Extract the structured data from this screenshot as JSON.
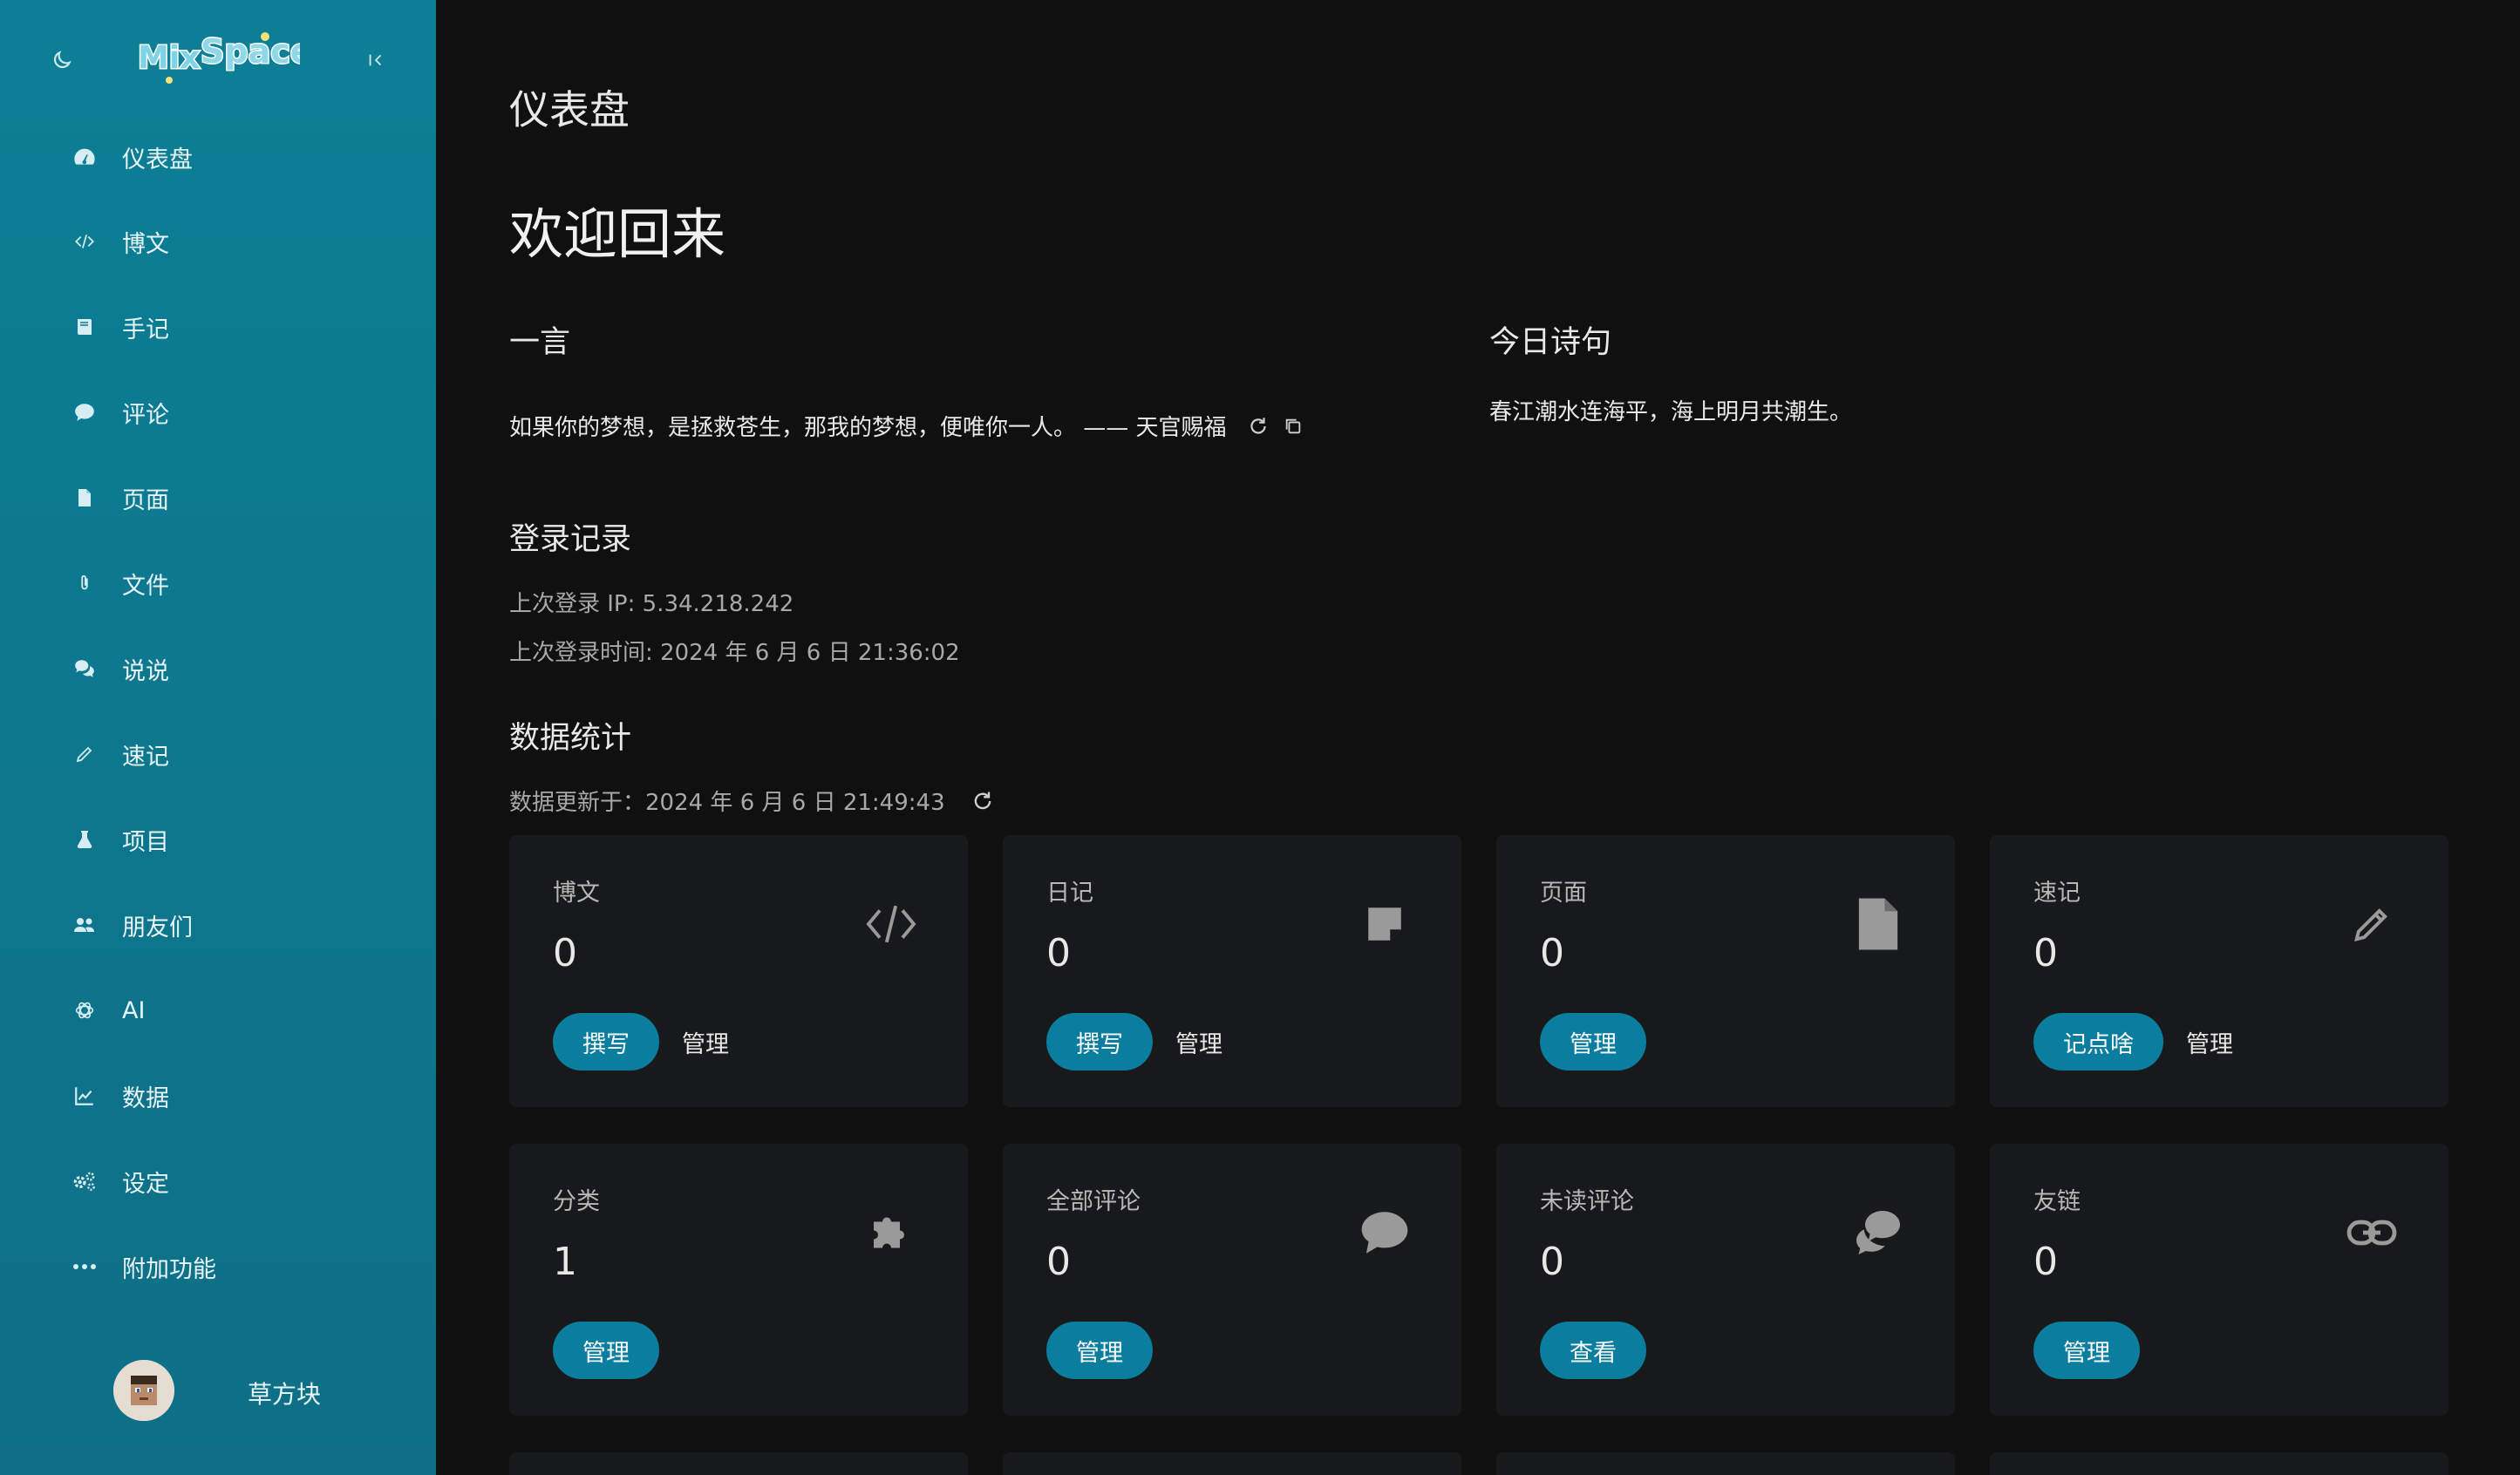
{
  "sidebar": {
    "logo_text": "Mix Space",
    "items": [
      {
        "label": "仪表盘",
        "icon": "dashboard-icon"
      },
      {
        "label": "博文",
        "icon": "code-icon"
      },
      {
        "label": "手记",
        "icon": "book-icon"
      },
      {
        "label": "评论",
        "icon": "comment-icon"
      },
      {
        "label": "页面",
        "icon": "file-icon"
      },
      {
        "label": "文件",
        "icon": "paperclip-icon"
      },
      {
        "label": "说说",
        "icon": "comments-icon"
      },
      {
        "label": "速记",
        "icon": "pencil-icon"
      },
      {
        "label": "项目",
        "icon": "flask-icon"
      },
      {
        "label": "朋友们",
        "icon": "users-icon"
      },
      {
        "label": "AI",
        "icon": "openai-icon"
      },
      {
        "label": "数据",
        "icon": "chart-line-icon"
      },
      {
        "label": "设定",
        "icon": "cogs-icon"
      },
      {
        "label": "附加功能",
        "icon": "ellipsis-icon"
      }
    ],
    "user_name": "草方块"
  },
  "main": {
    "page_title": "仪表盘",
    "welcome": "欢迎回来",
    "hitokoto": {
      "title": "一言",
      "text": "如果你的梦想，是拯救苍生，那我的梦想，便唯你一人。 —— 天官赐福"
    },
    "poem": {
      "title": "今日诗句",
      "text": "春江潮水连海平，海上明月共潮生。"
    },
    "login": {
      "title": "登录记录",
      "ip_line": "上次登录 IP: 5.34.218.242",
      "time_line": "上次登录时间: 2024 年 6 月 6 日 21:36:02"
    },
    "stats": {
      "title": "数据统计",
      "updated": "数据更新于：2024 年 6 月 6 日 21:49:43",
      "cards": [
        {
          "title": "博文",
          "value": "0",
          "icon": "code-icon",
          "primary": "撰写",
          "secondary": "管理"
        },
        {
          "title": "日记",
          "value": "0",
          "icon": "sticky-note-icon",
          "primary": "撰写",
          "secondary": "管理"
        },
        {
          "title": "页面",
          "value": "0",
          "icon": "file-icon",
          "primary": "管理",
          "secondary": ""
        },
        {
          "title": "速记",
          "value": "0",
          "icon": "pencil-icon",
          "primary": "记点啥",
          "secondary": "管理"
        },
        {
          "title": "分类",
          "value": "1",
          "icon": "puzzle-icon",
          "primary": "管理",
          "secondary": ""
        },
        {
          "title": "全部评论",
          "value": "0",
          "icon": "comment-icon",
          "primary": "管理",
          "secondary": ""
        },
        {
          "title": "未读评论",
          "value": "0",
          "icon": "comments-icon",
          "primary": "查看",
          "secondary": ""
        },
        {
          "title": "友链",
          "value": "0",
          "icon": "link-icon",
          "primary": "管理",
          "secondary": ""
        }
      ]
    }
  },
  "colors": {
    "sidebar": "#0c7f96",
    "background": "#101010",
    "card": "#18191b",
    "primary_button": "#0b7ea0"
  }
}
